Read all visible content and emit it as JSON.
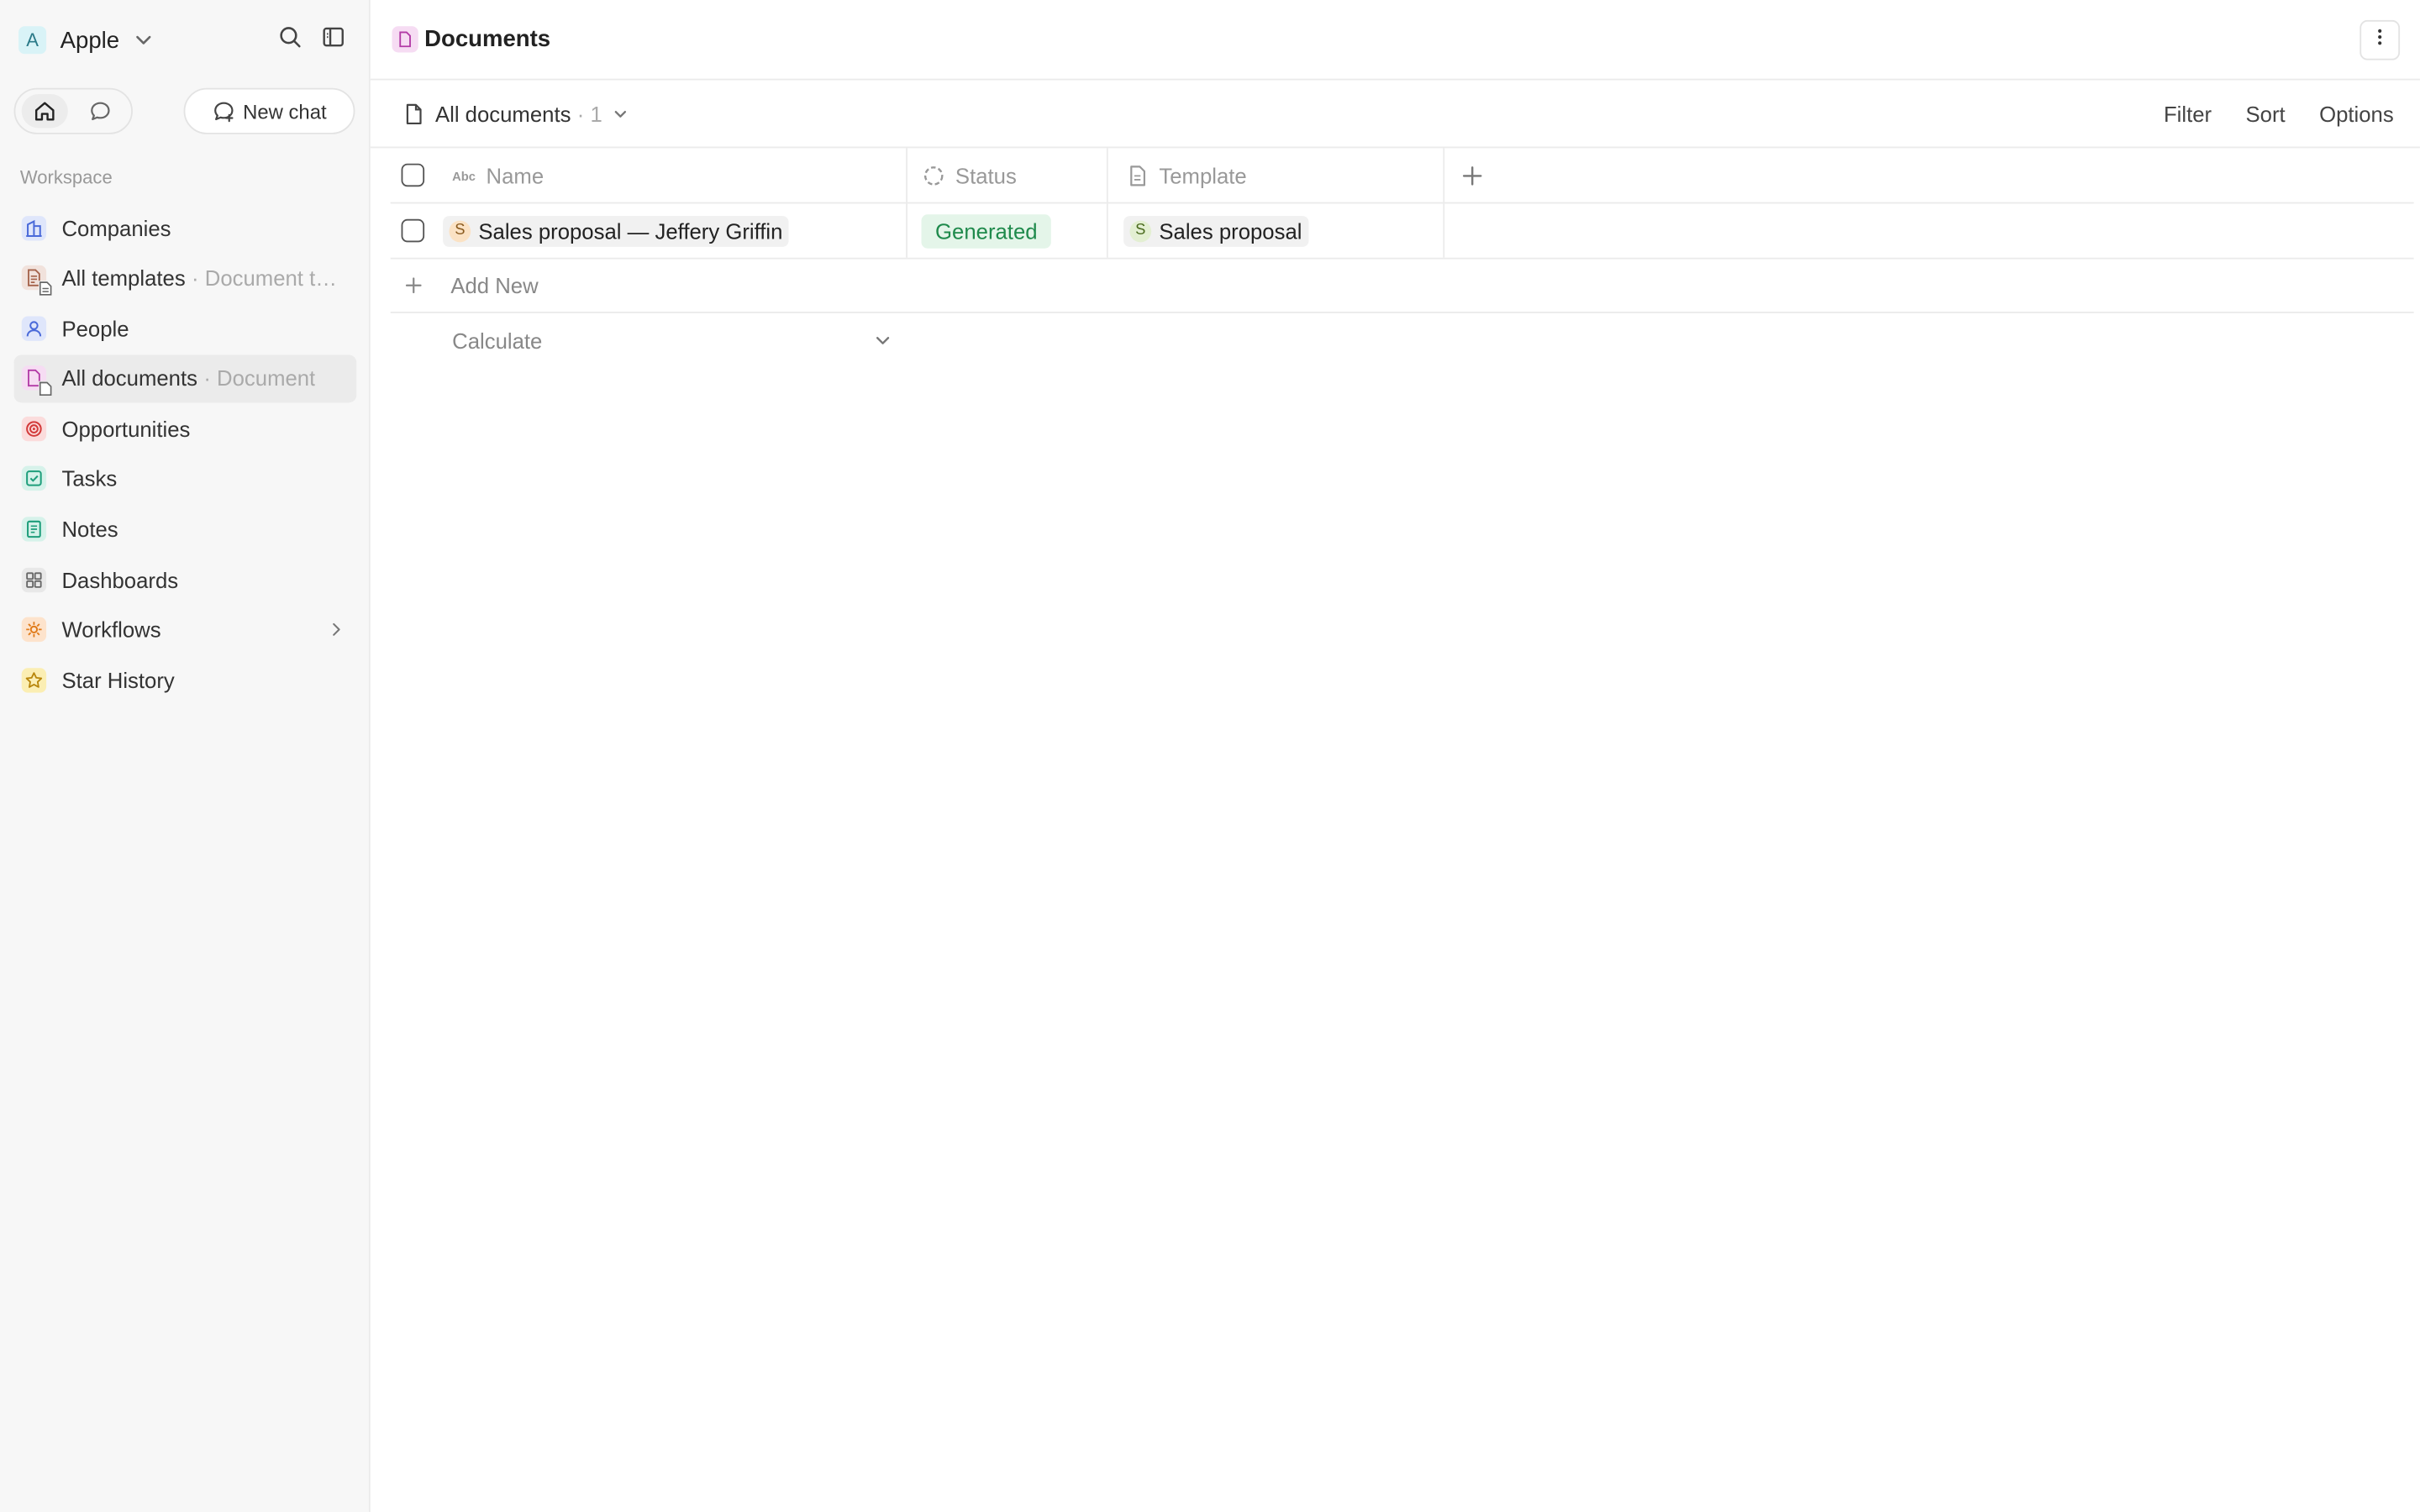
{
  "workspace": {
    "avatar_letter": "A",
    "name": "Apple"
  },
  "sidebar": {
    "new_chat_label": "New chat",
    "section_label": "Workspace",
    "items": [
      {
        "label": "Companies",
        "sub": "",
        "icon": "building-icon",
        "color": "#dfe6fb",
        "fg": "#4a6ad9"
      },
      {
        "label": "All templates",
        "sub": "· Document t…",
        "icon": "template-doc-icon",
        "color": "#f1e2dc",
        "fg": "#a4624a"
      },
      {
        "label": "People",
        "sub": "",
        "icon": "person-icon",
        "color": "#dfe6fb",
        "fg": "#4a6ad9"
      },
      {
        "label": "All documents",
        "sub": "· Document",
        "icon": "document-icon",
        "color": "#f6dcf3",
        "fg": "#b23aa6"
      },
      {
        "label": "Opportunities",
        "sub": "",
        "icon": "target-icon",
        "color": "#fbdcdc",
        "fg": "#d33b3b"
      },
      {
        "label": "Tasks",
        "sub": "",
        "icon": "checkbox-icon",
        "color": "#d6f2ea",
        "fg": "#1e9e7b"
      },
      {
        "label": "Notes",
        "sub": "",
        "icon": "notes-icon",
        "color": "#d6f2ea",
        "fg": "#1e9e7b"
      },
      {
        "label": "Dashboards",
        "sub": "",
        "icon": "dashboard-icon",
        "color": "#e8e8e8",
        "fg": "#666666"
      },
      {
        "label": "Workflows",
        "sub": "",
        "icon": "workflow-icon",
        "color": "#fde3cc",
        "fg": "#e07b1a"
      },
      {
        "label": "Star History",
        "sub": "",
        "icon": "star-icon",
        "color": "#fbeeb3",
        "fg": "#b8860b"
      }
    ]
  },
  "header": {
    "title": "Documents"
  },
  "view": {
    "name": "All documents",
    "count": "· 1",
    "filter_label": "Filter",
    "sort_label": "Sort",
    "options_label": "Options"
  },
  "table": {
    "columns": {
      "name": "Name",
      "status": "Status",
      "template": "Template"
    },
    "rows": [
      {
        "name": "Sales proposal — Jeffery Griffin",
        "name_avatar": "S",
        "status": "Generated",
        "template": "Sales proposal",
        "template_avatar": "S"
      }
    ],
    "add_new_label": "Add New",
    "calculate_label": "Calculate"
  }
}
